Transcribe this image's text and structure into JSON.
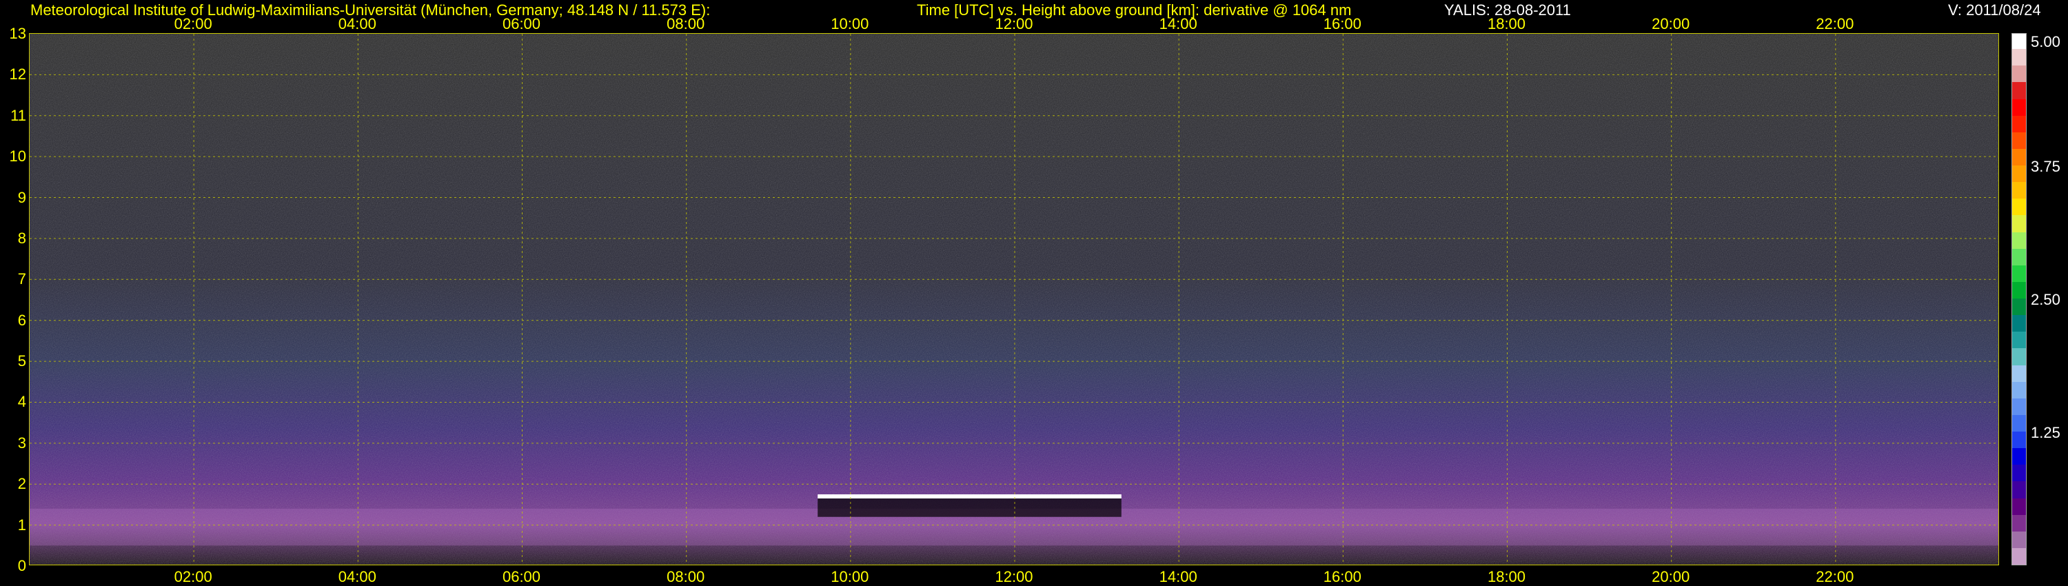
{
  "header": {
    "institute": "Meteorological Institute of Ludwig-Maximilians-Universität (München, Germany; 48.148 N / 11.573 E):",
    "title": "Time [UTC] vs. Height above ground [km]: derivative @ 1064 nm",
    "site": "YALIS: 28-08-2011",
    "version": "V: 2011/08/24"
  },
  "chart_data": {
    "type": "heatmap",
    "title": "Time [UTC] vs. Height above ground [km]: derivative @ 1064 nm",
    "x_ticks": [
      "02:00",
      "04:00",
      "06:00",
      "08:00",
      "10:00",
      "12:00",
      "14:00",
      "16:00",
      "18:00",
      "20:00",
      "22:00"
    ],
    "x_tick_hours": [
      2,
      4,
      6,
      8,
      10,
      12,
      14,
      16,
      18,
      20,
      22
    ],
    "xlim": [
      0,
      24
    ],
    "y_ticks": [
      "13",
      "12",
      "11",
      "10",
      "9",
      "8",
      "7",
      "6",
      "5",
      "4",
      "3",
      "2",
      "1",
      "0"
    ],
    "ylim": [
      0,
      13
    ],
    "grid": true,
    "colorbar": {
      "range": [
        0,
        5
      ],
      "ticks": [
        "5.00",
        "3.75",
        "2.50",
        "1.25"
      ],
      "tick_values": [
        5.0,
        3.75,
        2.5,
        1.25
      ],
      "colors": [
        "#c8a0c8",
        "#a070a8",
        "#803090",
        "#600080",
        "#4000a0",
        "#2000c0",
        "#0000e0",
        "#2040f0",
        "#4070f0",
        "#6090f0",
        "#80b0f0",
        "#a0c8f0",
        "#60c0c0",
        "#20a0a0",
        "#008080",
        "#009040",
        "#00b030",
        "#20d040",
        "#60e060",
        "#a0f060",
        "#e0f040",
        "#ffe000",
        "#ffc000",
        "#ffa000",
        "#ff8000",
        "#ff5000",
        "#ff2000",
        "#ff0000",
        "#e02020",
        "#e0a0a0",
        "#f0d0d0",
        "#ffffff"
      ]
    },
    "features": {
      "cloud_layer_height_km": 1.7,
      "cloud_time_range_h": [
        9.6,
        13.3
      ]
    }
  }
}
